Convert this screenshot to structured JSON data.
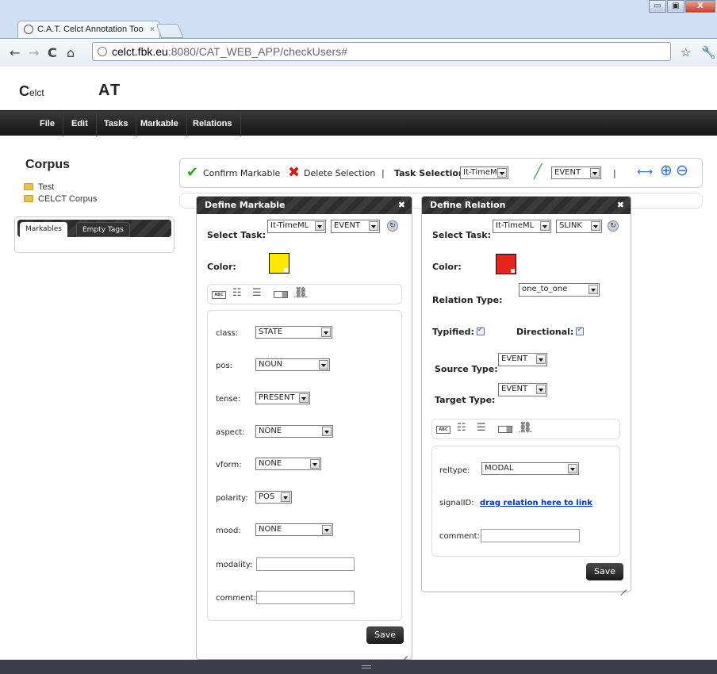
{
  "browser": {
    "tab_title": "C.A.T. Celct Annotation Too",
    "tab_close": "×",
    "url_host": "celct.fbk.eu",
    "url_rest": ":8080/CAT_WEB_APP/checkUsers#",
    "min": "▭",
    "max": "▣",
    "close": "X"
  },
  "app": {
    "logo_c": "C",
    "logo_rest": "elct",
    "logo2": "AT"
  },
  "menu": [
    "File",
    "Edit",
    "Tasks",
    "Markable",
    "Relations"
  ],
  "sidebar": {
    "title": "Corpus",
    "items": [
      "Test",
      "CELCT Corpus"
    ],
    "tabs": [
      "Markables",
      "Empty Tags"
    ]
  },
  "toolbar": {
    "confirm": "Confirm Markable",
    "delete": "Delete Selection",
    "sep1": "|",
    "task_label": "Task Selection",
    "task_value": "It-TimeML",
    "event_value": "EVENT",
    "sep2": "|"
  },
  "markable_dialog": {
    "title": "Define Markable",
    "close": "✖",
    "select_task_label": "Select Task:",
    "task_value": "It-TimeML",
    "tag_value": "EVENT",
    "color_label": "Color:",
    "color": "#ffe800",
    "abc": "ABC",
    "fields": [
      {
        "label": "class:",
        "value": "STATE"
      },
      {
        "label": "pos:",
        "value": "NOUN"
      },
      {
        "label": "tense:",
        "value": "PRESENT"
      },
      {
        "label": "aspect:",
        "value": "NONE"
      },
      {
        "label": "vform:",
        "value": "NONE"
      },
      {
        "label": "polarity:",
        "value": "POS"
      },
      {
        "label": "mood:",
        "value": "NONE"
      }
    ],
    "modality_label": "modality:",
    "comment_label": "comment:",
    "save": "Save"
  },
  "relation_dialog": {
    "title": "Define Relation",
    "close": "✖",
    "select_task_label": "Select Task:",
    "task_value": "It-TimeML",
    "tag_value": "SLINK",
    "color_label": "Color:",
    "color": "#e8231b",
    "relation_type_label": "Relation Type:",
    "relation_type_value": "one_to_one",
    "typified_label": "Typified:",
    "directional_label": "Directional:",
    "source_type_label": "Source Type:",
    "source_type_value": "EVENT",
    "target_type_label": "Target Type:",
    "target_type_value": "EVENT",
    "abc": "ABC",
    "reltype_label": "reltype:",
    "reltype_value": "MODAL",
    "signal_label": "signalID:",
    "signal_link": "drag relation here to link",
    "comment_label": "comment:",
    "save": "Save"
  }
}
